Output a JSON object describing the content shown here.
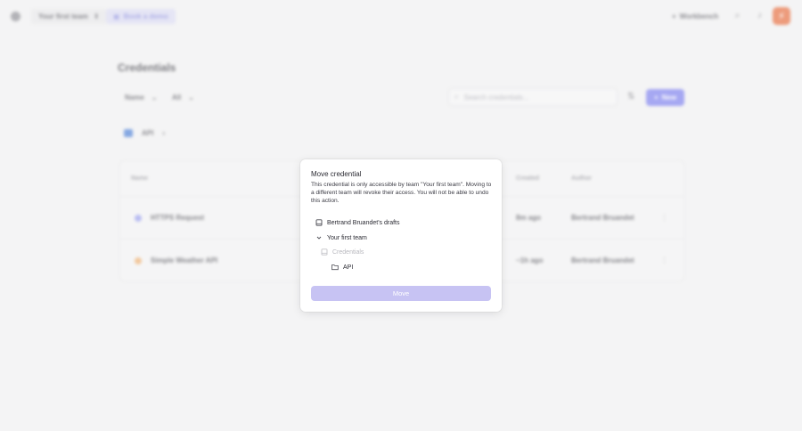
{
  "topbar": {
    "team_switch": "Your first team",
    "book_demo": "Book a demo",
    "workbench": "Workbench"
  },
  "page": {
    "title": "Credentials",
    "filter_name": "Name",
    "filter_all": "All",
    "search_placeholder": "Search credentials...",
    "new_button": "New",
    "crumb_folder": "API"
  },
  "table": {
    "headers": [
      "Name",
      "Created",
      "Author"
    ],
    "rows": [
      {
        "name": "HTTPS Request",
        "created": "8m ago",
        "author": "Bertrand Bruandet"
      },
      {
        "name": "Simple Weather API",
        "created": "~1h ago",
        "author": "Bertrand Bruandet"
      }
    ]
  },
  "modal": {
    "title": "Move credential",
    "description": "This credential is only accessible by team \"Your first team\". Moving to a different team will revoke their access. You will not be able to undo this action.",
    "tree": [
      {
        "label": "Bertrand Bruandet's drafts",
        "icon": "book-icon",
        "state": "normal"
      },
      {
        "label": "Your first team",
        "icon": "chevron-down-icon",
        "state": "expanded"
      },
      {
        "label": "Credentials",
        "icon": "book-icon",
        "state": "disabled"
      },
      {
        "label": "API",
        "icon": "folder-icon",
        "state": "normal"
      }
    ],
    "move_button": "Move"
  },
  "colors": {
    "accent": "#7b7ef0",
    "move_disabled": "#c7c3f3",
    "brand": "#e86a3a"
  }
}
